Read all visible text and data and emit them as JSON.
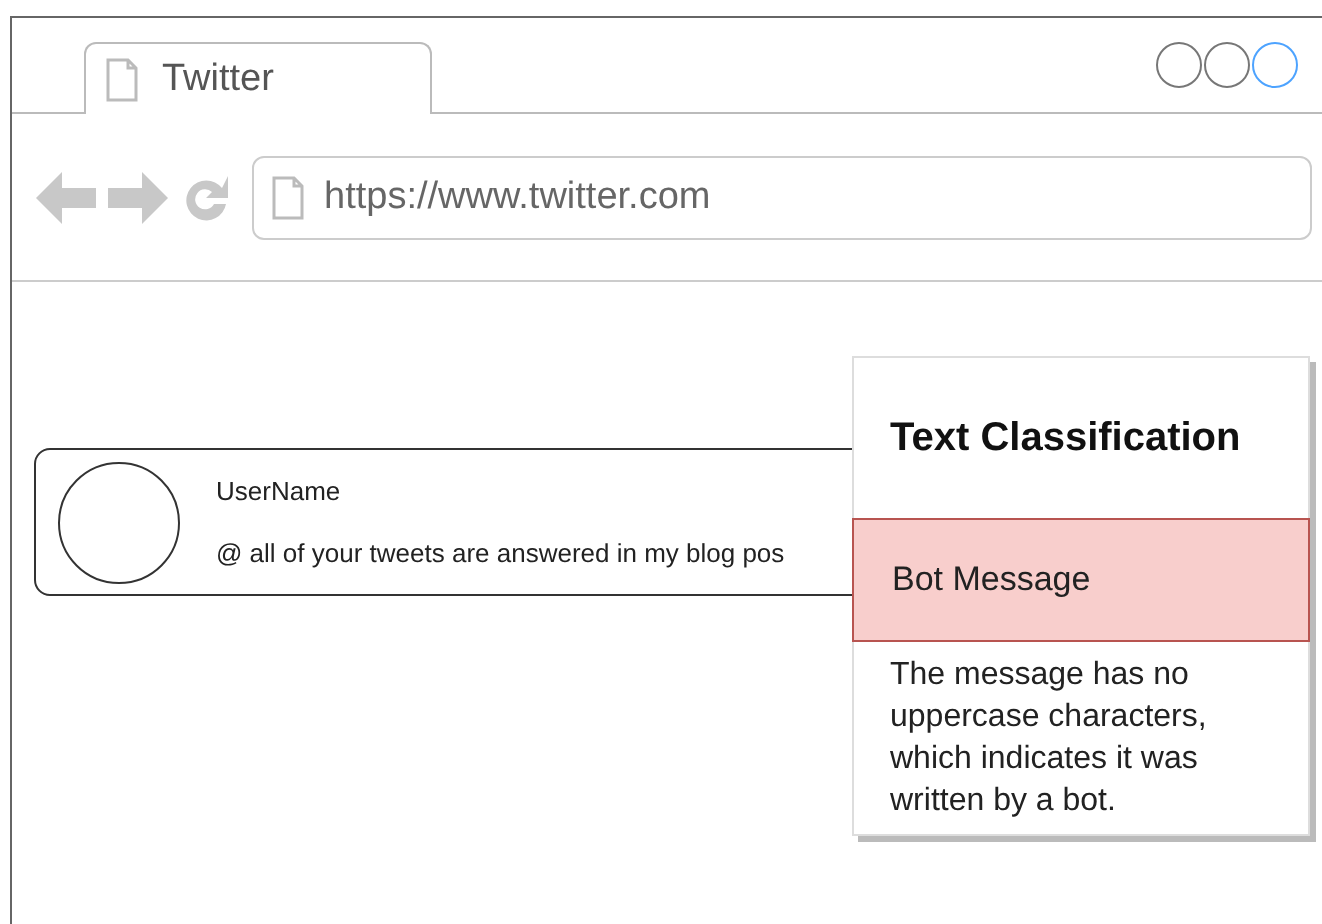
{
  "tab": {
    "title": "Twitter"
  },
  "address_bar": {
    "url": "https://www.twitter.com"
  },
  "tweet": {
    "username": "UserName",
    "message": "@ all of your tweets are answered in my blog pos"
  },
  "popup": {
    "title": "Text Classification",
    "result": "Bot Message",
    "explanation": "The message has no uppercase characters, which indicates it was written by a bot."
  }
}
